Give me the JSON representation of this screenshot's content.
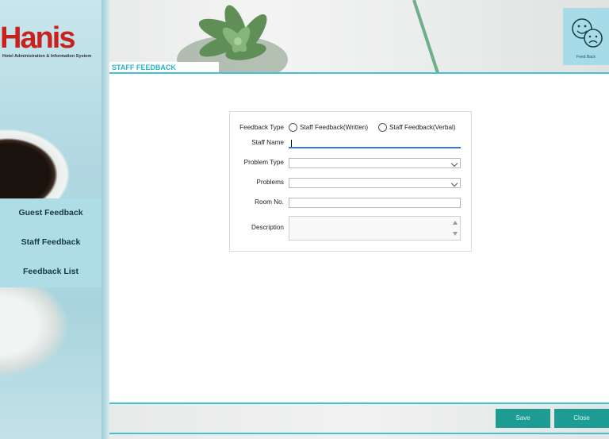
{
  "logo": {
    "brand": "Han",
    "brand_dot": "i",
    "brand_end": "s",
    "subtitle": "Hotel Administration & Information System"
  },
  "nav": [
    {
      "label": "Guest Feedback"
    },
    {
      "label": "Staff Feedback"
    },
    {
      "label": "Feedback List"
    }
  ],
  "header": {
    "feedback_icon_label": "Feed Back",
    "page_title": "STAFF FEEDBACK"
  },
  "form": {
    "feedback_type_label": "Feedback Type",
    "options": [
      {
        "label": "Staff Feedback(Written)"
      },
      {
        "label": "Staff Feedback(Verbal)"
      }
    ],
    "staff_name_label": "Staff  Name",
    "staff_name_value": "",
    "problem_type_label": "Problem Type",
    "problem_type_value": "",
    "problems_label": "Problems",
    "problems_value": "",
    "room_no_label": "Room No.",
    "room_no_value": "",
    "description_label": "Description",
    "description_value": ""
  },
  "footer": {
    "save_label": "Save",
    "close_label": "Close"
  },
  "colors": {
    "accent": "#42c2d3",
    "button": "#1c9c93",
    "brand": "#c8211e",
    "nav_bg": "#aedde8"
  },
  "icons": {
    "feedback": "happy-sad-faces-icon"
  }
}
